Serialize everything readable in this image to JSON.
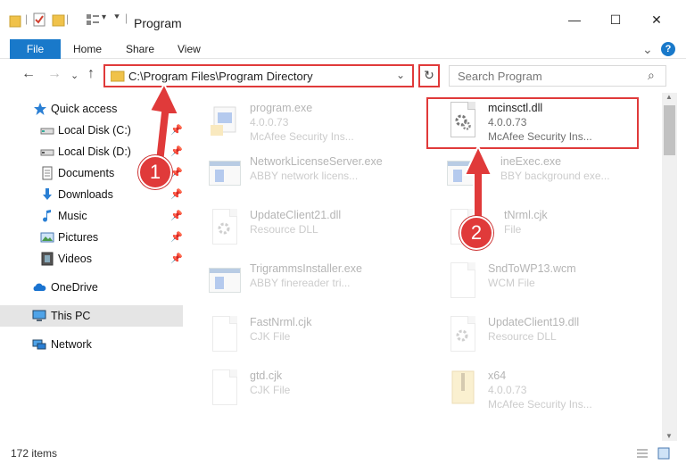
{
  "window": {
    "title": "Program",
    "minimize": "—",
    "maximize": "☐",
    "close": "✕"
  },
  "ribbon": {
    "file": "File",
    "tabs": [
      "Home",
      "Share",
      "View"
    ],
    "collapse": "⌄",
    "help": "?"
  },
  "nav": {
    "back": "←",
    "forward": "→",
    "recent": "⌄",
    "up": "↑",
    "address": "C:\\Program Files\\Program Directory",
    "address_dropdown": "⌄",
    "refresh": "↻",
    "search_placeholder": "Search Program",
    "search_icon": "⌕"
  },
  "sidebar": {
    "quick_access": "Quick access",
    "items": [
      {
        "label": "Local Disk (C:)",
        "icon": "drive-icon"
      },
      {
        "label": "Local Disk (D:)",
        "icon": "drive-icon"
      },
      {
        "label": "Documents",
        "icon": "documents-icon"
      },
      {
        "label": "Downloads",
        "icon": "downloads-icon"
      },
      {
        "label": "Music",
        "icon": "music-icon"
      },
      {
        "label": "Pictures",
        "icon": "pictures-icon"
      },
      {
        "label": "Videos",
        "icon": "videos-icon"
      }
    ],
    "onedrive": "OneDrive",
    "thispc": "This PC",
    "network": "Network"
  },
  "files": [
    {
      "name": "program.exe",
      "l2": "4.0.0.73",
      "l3": "McAfee Security Ins...",
      "kind": "exe"
    },
    {
      "name": "mcinsctl.dll",
      "l2": "4.0.0.73",
      "l3": "McAfee Security Ins...",
      "kind": "gear"
    },
    {
      "name": "NetworkLicenseServer.exe",
      "l2": "ABBY network licens...",
      "l3": "",
      "kind": "app"
    },
    {
      "name": "ineExec.exe",
      "l2": "BBY background exe...",
      "l3": "",
      "kind": "app"
    },
    {
      "name": "UpdateClient21.dll",
      "l2": "Resource DLL",
      "l3": "",
      "kind": "gear"
    },
    {
      "name": "tNrml.cjk",
      "l2": "File",
      "l3": "",
      "kind": "doc"
    },
    {
      "name": "TrigrammsInstaller.exe",
      "l2": "ABBY finereader tri...",
      "l3": "",
      "kind": "app"
    },
    {
      "name": "SndToWP13.wcm",
      "l2": "WCM File",
      "l3": "",
      "kind": "doc"
    },
    {
      "name": "FastNrml.cjk",
      "l2": "CJK File",
      "l3": "",
      "kind": "doc"
    },
    {
      "name": "UpdateClient19.dll",
      "l2": "Resource DLL",
      "l3": "",
      "kind": "gear"
    },
    {
      "name": "gtd.cjk",
      "l2": "CJK File",
      "l3": "",
      "kind": "doc"
    },
    {
      "name": "x64",
      "l2": "4.0.0.73",
      "l3": "McAfee Security Ins...",
      "kind": "zip"
    }
  ],
  "status": {
    "count": "172 items"
  },
  "annotations": {
    "badge1": "1",
    "badge2": "2"
  },
  "colors": {
    "accent": "#1979ca",
    "highlight": "#e03a3a"
  }
}
